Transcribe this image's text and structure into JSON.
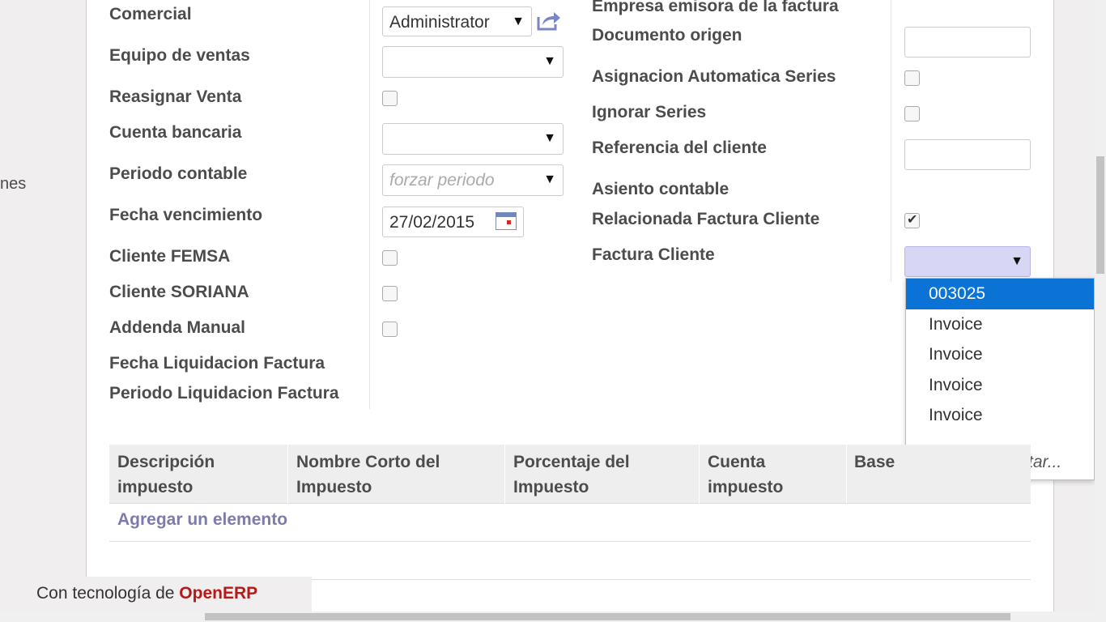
{
  "left_fragment": "nes",
  "left_fields": [
    {
      "label": "Comercial"
    },
    {
      "label": "Equipo de ventas"
    },
    {
      "label": "Reasignar Venta"
    },
    {
      "label": "Cuenta bancaria"
    },
    {
      "label": "Periodo contable"
    },
    {
      "label": "Fecha vencimiento"
    },
    {
      "label": "Cliente FEMSA"
    },
    {
      "label": "Cliente SORIANA"
    },
    {
      "label": "Addenda Manual"
    },
    {
      "label": "Fecha Liquidacion Factura"
    },
    {
      "label": "Periodo Liquidacion Factura"
    }
  ],
  "comercial_value": "Administrator",
  "periodo_placeholder": "forzar periodo",
  "fecha_vencimiento_value": "27/02/2015",
  "right_fields": [
    {
      "label": "Empresa emisora de la factura"
    },
    {
      "label": "Documento origen"
    },
    {
      "label": "Asignacion Automatica Series"
    },
    {
      "label": "Ignorar Series"
    },
    {
      "label": "Referencia del cliente"
    },
    {
      "label": "Asiento contable"
    },
    {
      "label": "Relacionada Factura Cliente"
    },
    {
      "label": "Factura Cliente"
    }
  ],
  "checkboxes": {
    "reasignar_venta": false,
    "cliente_femsa": false,
    "cliente_soriana": false,
    "addenda_manual": false,
    "asignacion_automatica_series": false,
    "ignorar_series": false,
    "relacionada_factura_cliente": true
  },
  "dropdown": {
    "items": [
      "003025",
      "Invoice",
      "Invoice",
      "Invoice",
      "Invoice"
    ],
    "selected_index": 0,
    "create_label": "Crear y Editar..."
  },
  "table": {
    "headers": [
      {
        "line1": "Descripción",
        "line2": "impuesto"
      },
      {
        "line1": "Nombre Corto del",
        "line2": "Impuesto"
      },
      {
        "line1": "Porcentaje del",
        "line2": "Impuesto"
      },
      {
        "line1": "Cuenta",
        "line2": "impuesto"
      },
      {
        "line1": "Base",
        "line2": ""
      }
    ],
    "add_label": "Agregar un elemento"
  },
  "footer": {
    "prefix": "Con tecnología de ",
    "brand": "OpenERP"
  },
  "colors": {
    "selected_item": "#0b72d6",
    "focused_field": "#d7d7f5",
    "link": "#7c7bad",
    "brand": "#b31a1a"
  }
}
